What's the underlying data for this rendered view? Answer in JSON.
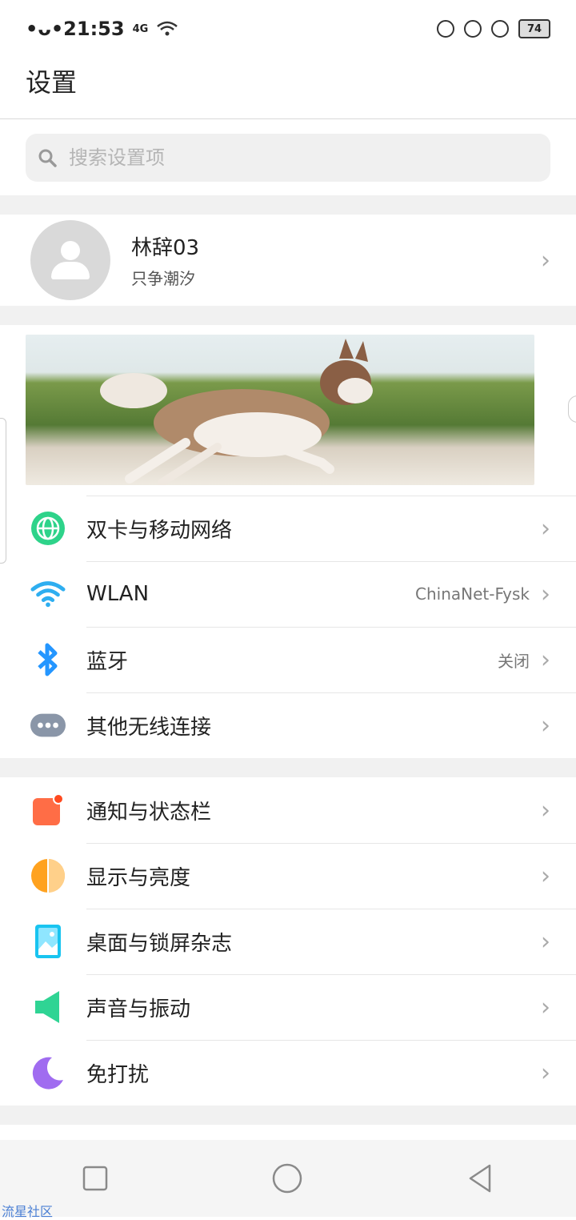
{
  "status_bar": {
    "time": "•ᴗ•21:53",
    "network": "4G",
    "battery": "74"
  },
  "header": {
    "title": "设置"
  },
  "search": {
    "placeholder": "搜索设置项"
  },
  "profile": {
    "name": "林辞03",
    "subtitle": "只争潮汐"
  },
  "group1": [
    {
      "label": "双卡与移动网络",
      "value": "",
      "icon": "globe-icon",
      "color": "#2ed38a"
    },
    {
      "label": "WLAN",
      "value": "ChinaNet-Fysk",
      "icon": "wifi-icon",
      "color": "#2eaef0"
    },
    {
      "label": "蓝牙",
      "value": "关闭",
      "icon": "bluetooth-icon",
      "color": "#2496ff"
    },
    {
      "label": "其他无线连接",
      "value": "",
      "icon": "more-dots-icon",
      "color": "#8a96a8"
    }
  ],
  "group2": [
    {
      "label": "通知与状态栏",
      "icon": "notification-icon",
      "color": "#ff6d46"
    },
    {
      "label": "显示与亮度",
      "icon": "brightness-icon",
      "color": "#ffa21f"
    },
    {
      "label": "桌面与锁屏杂志",
      "icon": "wallpaper-icon",
      "color": "#19c4f0"
    },
    {
      "label": "声音与振动",
      "icon": "speaker-icon",
      "color": "#2fd494"
    },
    {
      "label": "免打扰",
      "icon": "moon-icon",
      "color": "#a06cf0"
    }
  ],
  "navbar": {
    "items": [
      "recent-apps-button",
      "home-button",
      "back-button"
    ]
  },
  "watermark": "流星社区"
}
